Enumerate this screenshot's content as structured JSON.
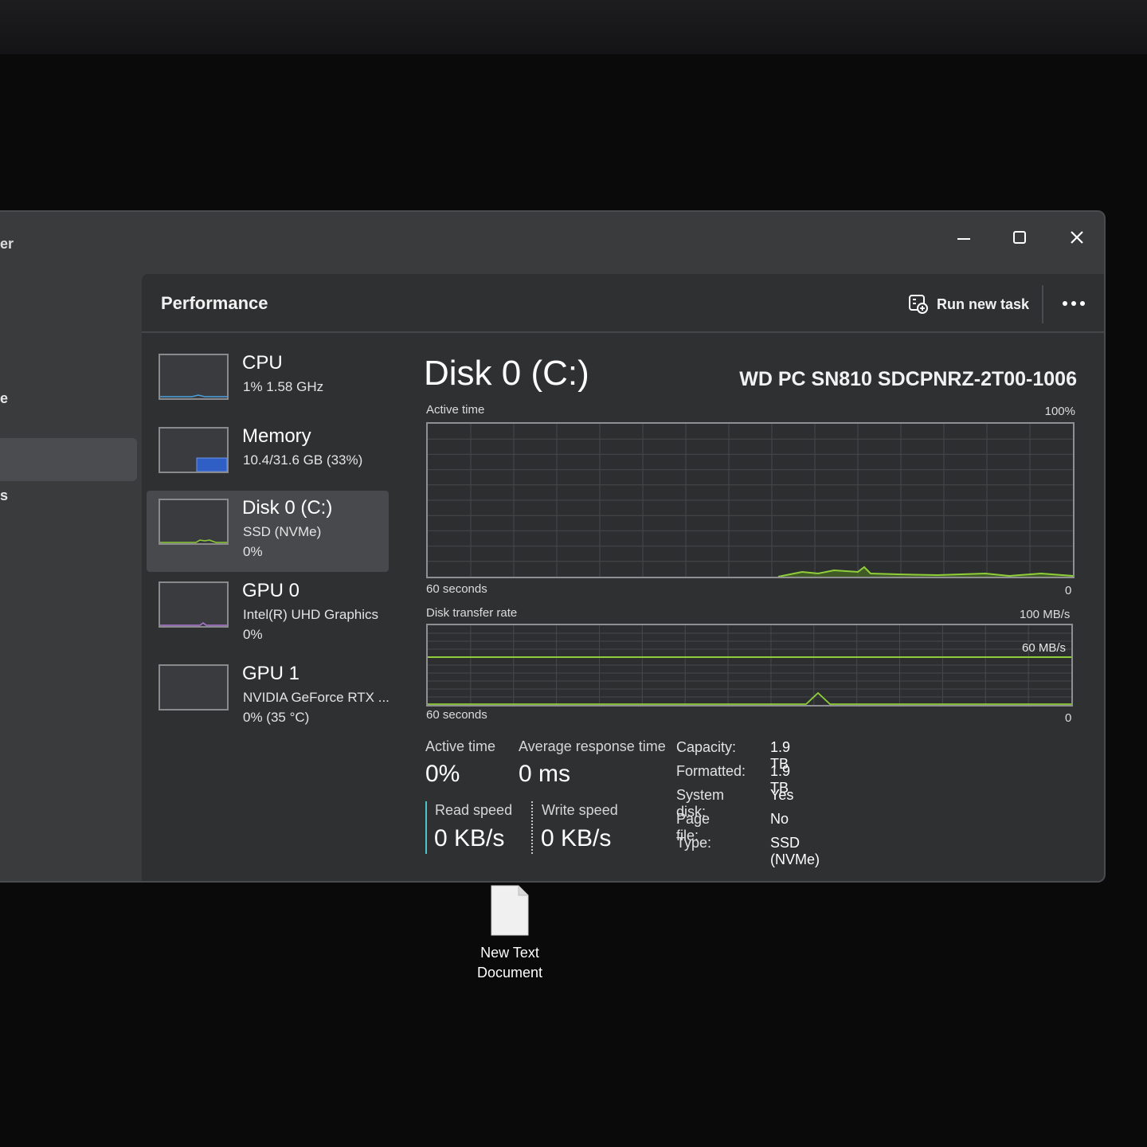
{
  "window": {
    "title_fragment": "er",
    "controls": {
      "minimize": "minimize-icon",
      "maximize": "maximize-icon",
      "close": "close-icon"
    }
  },
  "nav": {
    "fragments": [
      "e",
      "s"
    ]
  },
  "header": {
    "title": "Performance",
    "run_task_label": "Run new task",
    "run_task_icon": "run-task-icon",
    "more_icon": "more-icon"
  },
  "devices": [
    {
      "name": "CPU",
      "line2": "1%  1.58 GHz",
      "line3": ""
    },
    {
      "name": "Memory",
      "line2": "10.4/31.6 GB (33%)",
      "line3": ""
    },
    {
      "name": "Disk 0 (C:)",
      "line2": "SSD (NVMe)",
      "line3": "0%"
    },
    {
      "name": "GPU 0",
      "line2": "Intel(R) UHD Graphics",
      "line3": "0%"
    },
    {
      "name": "GPU 1",
      "line2": "NVIDIA GeForce RTX ...",
      "line3": "0%  (35 °C)"
    }
  ],
  "detail": {
    "title": "Disk 0 (C:)",
    "model": "WD PC SN810 SDCPNRZ-2T00-1006",
    "active_graph": {
      "label": "Active time",
      "max": "100%",
      "time": "60 seconds",
      "min": "0"
    },
    "transfer_graph": {
      "label": "Disk transfer rate",
      "max": "100 MB/s",
      "mid": "60 MB/s",
      "time": "60 seconds",
      "min": "0"
    },
    "stats": {
      "active_time_label": "Active time",
      "active_time_value": "0%",
      "avg_resp_label": "Average response time",
      "avg_resp_value": "0 ms",
      "read_label": "Read speed",
      "read_value": "0 KB/s",
      "write_label": "Write speed",
      "write_value": "0 KB/s"
    },
    "properties": [
      {
        "key": "Capacity:",
        "value": "1.9 TB"
      },
      {
        "key": "Formatted:",
        "value": "1.9 TB"
      },
      {
        "key": "System disk:",
        "value": "Yes"
      },
      {
        "key": "Page file:",
        "value": "No"
      },
      {
        "key": "Type:",
        "value": "SSD (NVMe)"
      }
    ]
  },
  "desktop_icon": {
    "line1": "New Text",
    "line2": "Document",
    "icon": "text-document-icon"
  },
  "colors": {
    "graph_line": "#8fce3a",
    "memory_fill": "#2f5fc4",
    "read_bar": "#4fc3c8"
  }
}
